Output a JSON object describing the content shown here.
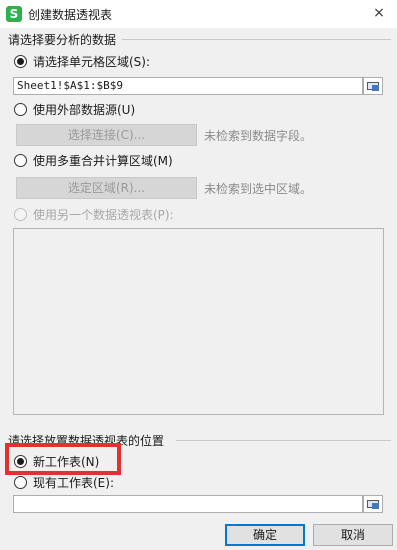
{
  "window": {
    "title": "创建数据透视表",
    "app_icon_letter": "S",
    "close_symbol": "×"
  },
  "source_section": {
    "title": "请选择要分析的数据",
    "options": [
      {
        "label": "请选择单元格区域(S):",
        "checked": true,
        "disabled": false
      },
      {
        "label": "使用外部数据源(U)",
        "checked": false,
        "disabled": false
      },
      {
        "label": "使用多重合并计算区域(M)",
        "checked": false,
        "disabled": false
      },
      {
        "label": "使用另一个数据透视表(P):",
        "checked": false,
        "disabled": true
      }
    ],
    "range_value": "Sheet1!$A$1:$B$9",
    "select_connection_button": "选择连接(C)...",
    "no_fields_hint": "未检索到数据字段。",
    "select_range_button": "选定区域(R)...",
    "no_range_hint": "未检索到选中区域。"
  },
  "destination_section": {
    "title": "请选择放置数据透视表的位置",
    "options": [
      {
        "label": "新工作表(N)",
        "checked": true
      },
      {
        "label": "现有工作表(E):",
        "checked": false
      }
    ],
    "location_value": ""
  },
  "footer": {
    "ok_label": "确定",
    "cancel_label": "取消"
  },
  "colors": {
    "highlight_border": "#e53030",
    "app_icon": "#2bb24c",
    "default_button_border": "#0078d7"
  }
}
